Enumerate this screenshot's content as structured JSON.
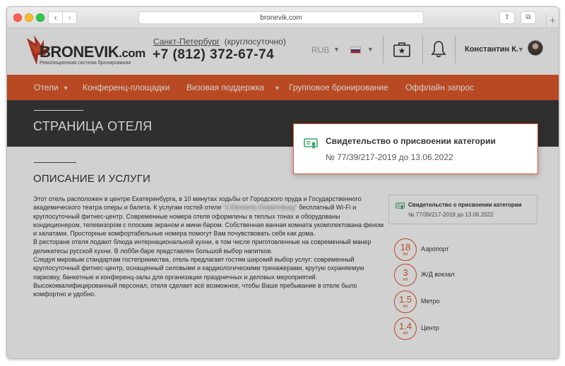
{
  "browser": {
    "url": "bronevik.com",
    "back_glyph": "‹",
    "forward_glyph": "›",
    "share_glyph": "⇪",
    "tabs_glyph": "⧉",
    "newtab_glyph": "+"
  },
  "header": {
    "logo_text": "BRONEVIK",
    "logo_domain": ".com",
    "logo_tagline": "Революционная система бронирования",
    "city": "Санкт-Петербург",
    "hours": "(круглосуточно)",
    "phone": "+7 (812) 372-67-74",
    "currency": "RUB",
    "user_name": "Константин К.",
    "caret": "▼"
  },
  "nav": {
    "items": [
      {
        "label": "Отели",
        "caret": "▼"
      },
      {
        "label": "Конференц-площадки"
      },
      {
        "label": "Визовая поддержка",
        "caret": "▼"
      },
      {
        "label": "Групповое бронирование"
      },
      {
        "label": "Оффлайн запрос"
      }
    ]
  },
  "page": {
    "title": "СТРАНИЦА ОТЕЛЯ",
    "section_title": "ОПИСАНИЕ И УСЛУГИ",
    "desc_1_pre": "Этот отель расположен в центре Екатеринбурга, в 10 минутах ходьбы от Городского пруда и Государственного академического театра оперы и балета. К услугам гостей отеля",
    "desc_1_blur": "\"4 Elements Ekaterinburg\"",
    "desc_1_post": "бесплатный Wi-Fi и круглосуточный фитнес-центр. Современные номера отеля оформлены в теплых тонах и оборудованы кондиционером, телевизором с плоским экраном и мини-баром. Собственная ванная комната укомплектована феном и халатами. Просторные комфортабельные номера помогут Вам почувствовать себя как дома.",
    "desc_2": "В ресторане отеля подают блюда интернациональной кухни, в том числе приготовленные на современный манер деликатесы русской кухни. В лобби-баре представлен большой выбор напитков.",
    "desc_3": "Следуя мировым стандартам гостеприимства, отель предлагает гостям широкий выбор услуг: современный круглосуточный фитнес-центр, оснащенный силовыми и кардиологическими тренажерами, крутую охраняемую парковку, банкетные и конференц-залы для организации праздничных и деловых мероприятий. Высококвалифицированный персонал, отеля сделает всё возможное, чтобы Ваше пребывание в отеле было комфортно и удобно."
  },
  "certificate": {
    "title": "Свидетельство о присвоении категории",
    "number": "№ 77/39/217-2019 до 13.06.2022"
  },
  "distances": [
    {
      "value": "18",
      "unit": "КМ",
      "label": "Аэропорт"
    },
    {
      "value": "3",
      "unit": "КМ",
      "label": "Ж/Д вокзал"
    },
    {
      "value": "1.5",
      "unit": "КМ",
      "label": "Метро"
    },
    {
      "value": "1.4",
      "unit": "КМ",
      "label": "Центр"
    }
  ],
  "colors": {
    "accent": "#e1592a",
    "dark_band": "#3a3a3a",
    "certificate_icon": "#3aa86b"
  },
  "icons": {
    "portfolio": "briefcase-star-icon",
    "notifications": "bell-icon",
    "certificate": "certificate-icon",
    "language": "russian-flag-icon"
  }
}
